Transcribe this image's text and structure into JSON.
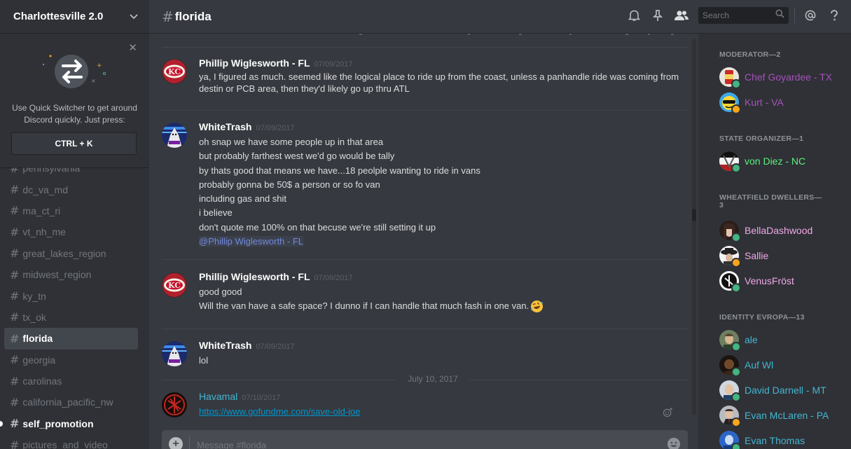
{
  "server": {
    "name": "Charlottesville 2.0"
  },
  "switcher": {
    "text": "Use Quick Switcher to get around Discord quickly. Just press:",
    "shortcut": "CTRL + K"
  },
  "channels": [
    {
      "name": "pennsylvania",
      "state": "normal"
    },
    {
      "name": "dc_va_md",
      "state": "normal"
    },
    {
      "name": "ma_ct_ri",
      "state": "normal"
    },
    {
      "name": "vt_nh_me",
      "state": "normal"
    },
    {
      "name": "great_lakes_region",
      "state": "normal"
    },
    {
      "name": "midwest_region",
      "state": "normal"
    },
    {
      "name": "ky_tn",
      "state": "normal"
    },
    {
      "name": "tx_ok",
      "state": "normal"
    },
    {
      "name": "florida",
      "state": "active"
    },
    {
      "name": "georgia",
      "state": "normal"
    },
    {
      "name": "carolinas",
      "state": "normal"
    },
    {
      "name": "california_pacific_nw",
      "state": "normal"
    },
    {
      "name": "self_promotion",
      "state": "unread"
    },
    {
      "name": "pictures_and_video",
      "state": "normal"
    }
  ],
  "header": {
    "channel": "florida",
    "search_placeholder": "Search"
  },
  "messages": [
    {
      "author": "Phillip Wiglesworth - FL",
      "date": "07/09/2017",
      "avatar": "chiefs-logo",
      "lines": [
        "ya, I figured as much.  seemed like the logical place to ride up from the coast, unless a panhandle ride was coming from destin or PCB area, then they'd likely go up thru ATL"
      ]
    },
    {
      "author": "WhiteTrash",
      "date": "07/09/2017",
      "avatar": "robed-figure",
      "lines": [
        "oh snap we have some people up in that area",
        "but probably farthest west we'd go would be tally",
        "by thats good that means we have...18 peolple wanting to ride in vans",
        "probably gonna be 50$ a person or so fo van",
        "including gas and shit",
        "i believe",
        "don't quote me 100% on that becuse we're still setting it up"
      ],
      "mention": "@Phillip Wiglesworth - FL"
    },
    {
      "author": "Phillip Wiglesworth - FL",
      "date": "07/09/2017",
      "avatar": "chiefs-logo",
      "lines": [
        "good good",
        "Will the van have a safe space? I dunno if I can handle that much fash in one van."
      ],
      "emoji": "rofl-emoji"
    },
    {
      "author": "WhiteTrash",
      "date": "07/09/2017",
      "avatar": "robed-figure",
      "lines": [
        "lol"
      ]
    },
    {
      "author": "Havamal",
      "date": "07/10/2017",
      "avatar": "red-rune",
      "link": "https://www.gofundme.com/save-old-joe"
    }
  ],
  "date_divider": "July 10, 2017",
  "composer": {
    "placeholder": "Message #florida"
  },
  "member_groups": [
    {
      "title": "MODERATOR—2",
      "members": [
        {
          "name": "Chef Goyardee - TX",
          "color": "#a652bb",
          "status": "online",
          "avatar": "can-avatar"
        },
        {
          "name": "Kurt - VA",
          "color": "#a652bb",
          "status": "idle",
          "avatar": "sunglasses-avatar"
        }
      ]
    },
    {
      "title": "STATE ORGANIZER—1",
      "members": [
        {
          "name": "von Diez - NC",
          "color": "#5cf07e",
          "status": "online",
          "avatar": "flag-avatar"
        }
      ]
    },
    {
      "title": "WHEATFIELD DWELLERS—3",
      "members": [
        {
          "name": "BellaDashwood",
          "color": "#f1a8e8",
          "status": "online",
          "avatar": "portrait-avatar"
        },
        {
          "name": "Sallie",
          "color": "#f1a8e8",
          "status": "idle",
          "avatar": "hat-avatar"
        },
        {
          "name": "VenusFröst",
          "color": "#f1a8e8",
          "status": "online",
          "avatar": "bw-avatar"
        }
      ]
    },
    {
      "title": "IDENTITY EVROPA—13",
      "members": [
        {
          "name": "ale",
          "color": "#43b5d1",
          "status": "online",
          "avatar": "man-avatar"
        },
        {
          "name": "Auf Wl",
          "color": "#43b5d1",
          "status": "online",
          "avatar": "dark-avatar"
        },
        {
          "name": "David Darnell - MT",
          "color": "#43b5d1",
          "status": "online",
          "avatar": "bald-avatar"
        },
        {
          "name": "Evan McLaren - PA",
          "color": "#43b5d1",
          "status": "idle",
          "avatar": "suit-avatar"
        },
        {
          "name": "Evan Thomas",
          "color": "#43b5d1",
          "status": "online",
          "avatar": "blue-avatar"
        }
      ]
    }
  ],
  "colors": {
    "online": "#43b581",
    "idle": "#faa61a",
    "accent": "#7289da"
  }
}
